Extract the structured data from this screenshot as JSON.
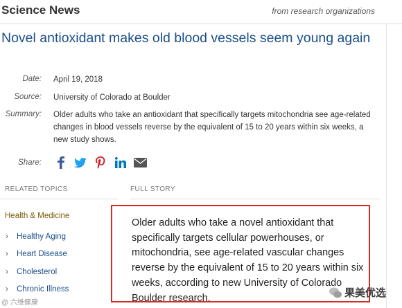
{
  "masthead": {
    "brand": "Science News",
    "tagline": "from research organizations"
  },
  "article": {
    "headline": "Novel antioxidant makes old blood vessels seem young again",
    "meta": {
      "date_label": "Date:",
      "date": "April 19, 2018",
      "source_label": "Source:",
      "source": "University of Colorado at Boulder",
      "summary_label": "Summary:",
      "summary": "Older adults who take an antioxidant that specifically targets mitochondria see age-related changes in blood vessels reverse by the equivalent of 15 to 20 years within six weeks, a new study shows."
    },
    "share": {
      "label": "Share:",
      "icons": [
        "facebook-icon",
        "twitter-icon",
        "pinterest-icon",
        "linkedin-icon",
        "email-icon"
      ]
    },
    "full_story": {
      "header": "FULL STORY",
      "text": "Older adults who take a novel antioxidant that specifically targets cellular powerhouses, or mitochondria, see age-related vascular changes reverse by the equivalent of 15 to 20 years within six weeks, according to new University of Colorado Boulder research."
    }
  },
  "related_topics": {
    "header": "RELATED TOPICS",
    "parent": "Health & Medicine",
    "items": [
      "Healthy Aging",
      "Heart Disease",
      "Cholesterol",
      "Chronic Illness"
    ]
  },
  "watermarks": {
    "left": "@ 六维健康",
    "right": "果美优选"
  },
  "colors": {
    "headline": "#1a4e8b",
    "highlight_box": "#d62b2b",
    "topic_parent": "#7a5a00",
    "facebook": "#3b5998",
    "twitter": "#1da1f2",
    "pinterest": "#cb2027",
    "linkedin": "#0077b5",
    "email": "#555555"
  }
}
